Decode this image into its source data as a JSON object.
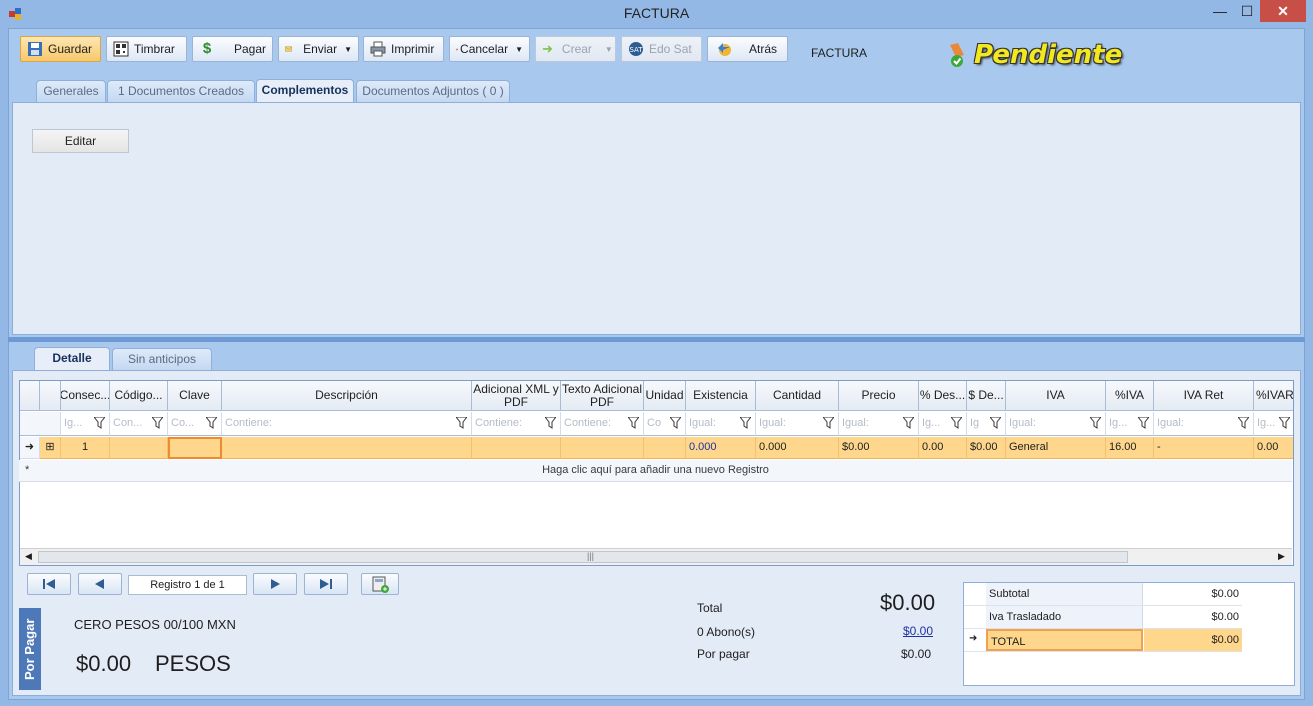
{
  "window": {
    "title": "FACTURA",
    "minimize": "—",
    "maximize": "☐",
    "close": "✕"
  },
  "toolbar": {
    "buttons": [
      {
        "key": "guardar",
        "label": "Guardar",
        "icon": "save-icon"
      },
      {
        "key": "timbrar",
        "label": "Timbrar",
        "icon": "qr-icon"
      },
      {
        "key": "pagar",
        "label": "Pagar",
        "icon": "dollar-icon"
      },
      {
        "key": "enviar",
        "label": "Enviar",
        "icon": "envelope-icon"
      },
      {
        "key": "imprimir",
        "label": "Imprimir",
        "icon": "printer-icon"
      },
      {
        "key": "cancelar",
        "label": "Cancelar",
        "icon": "cancel-icon"
      },
      {
        "key": "crear",
        "label": "Crear",
        "icon": "arrow-right-icon"
      },
      {
        "key": "edosat",
        "label": "Edo Sat",
        "icon": "sat-icon"
      },
      {
        "key": "atras",
        "label": "Atrás",
        "icon": "back-icon"
      }
    ],
    "doc_label": "FACTURA",
    "status": "Pendiente"
  },
  "tabs_top": [
    {
      "label": "Generales"
    },
    {
      "label": "1 Documentos Creados"
    },
    {
      "label": "Complementos"
    },
    {
      "label": "Documentos Adjuntos ( 0 )"
    }
  ],
  "complementos": {
    "edit_button": "Editar"
  },
  "tabs_bottom": [
    {
      "label": "Detalle"
    },
    {
      "label": "Sin anticipos"
    }
  ],
  "grid": {
    "headers": [
      "Consec...",
      "Código...",
      "Clave",
      "Descripción",
      "Adicional XML y PDF",
      "Texto Adicional PDF",
      "Unidad",
      "Existencia",
      "Cantidad",
      "Precio",
      "% Des...",
      "$ De...",
      "IVA",
      "%IVA",
      "IVA Ret",
      "%IVARe"
    ],
    "filters": [
      "Ig...",
      "Con...",
      "Co...",
      "Contiene:",
      "Contiene:",
      "Contiene:",
      "Co",
      "Igual:",
      "Igual:",
      "Igual:",
      "Ig...",
      "Ig",
      "Igual:",
      "Ig...",
      "Igual:",
      "Ig..."
    ],
    "row": [
      "1",
      "",
      "",
      "",
      "",
      "",
      "",
      "0.000",
      "0.000",
      "$0.00",
      "0.00",
      "$0.00",
      "General",
      "16.00",
      "-",
      "0.00"
    ],
    "new_row_hint": "Haga clic aquí para añadir una nuevo Registro",
    "new_row_marker": "*",
    "row_marker": "➜",
    "expand": "⊞"
  },
  "navigator": {
    "registro": "Registro  1  de  1"
  },
  "por_pagar_tag": "Por Pagar",
  "amount_words": "CERO PESOS 00/100 MXN",
  "amount_big": "$0.00",
  "currency_word": "PESOS",
  "summary": {
    "total_label": "Total",
    "total_value": "$0.00",
    "abonos_label": "0 Abono(s)",
    "abonos_value": "$0.00",
    "por_pagar_label": "Por pagar",
    "por_pagar_value": "$0.00"
  },
  "totals": [
    {
      "label": "Subtotal",
      "value": "$0.00"
    },
    {
      "label": "Iva Trasladado",
      "value": "$0.00"
    },
    {
      "label": "TOTAL",
      "value": "$0.00"
    }
  ],
  "colors": {
    "frame": "#a9c8ee",
    "selected_row": "#fed68c",
    "status_text": "#f3e81f",
    "close": "#c74f48"
  }
}
